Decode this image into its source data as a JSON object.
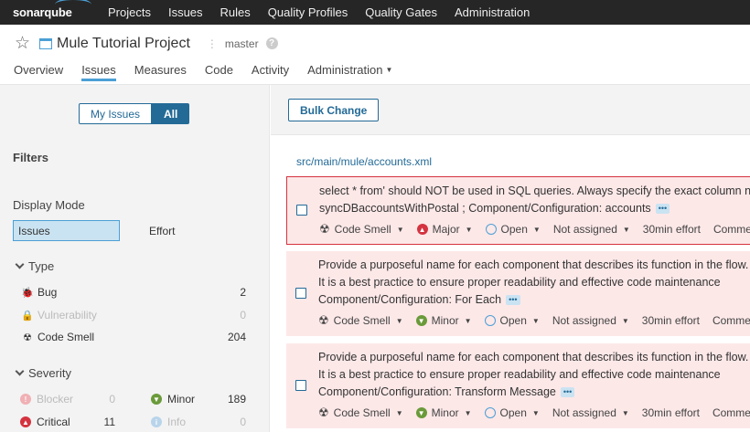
{
  "topnav": {
    "logo": "sonarqube",
    "links": [
      "Projects",
      "Issues",
      "Rules",
      "Quality Profiles",
      "Quality Gates",
      "Administration"
    ]
  },
  "project": {
    "name": "Mule Tutorial Project",
    "branch": "master",
    "tabs": [
      "Overview",
      "Issues",
      "Measures",
      "Code",
      "Activity",
      "Administration"
    ],
    "active_tab": "Issues"
  },
  "sidebar": {
    "toggle": {
      "my_issues": "My Issues",
      "all": "All"
    },
    "filters_title": "Filters",
    "display_mode": {
      "title": "Display Mode",
      "issues": "Issues",
      "effort": "Effort"
    },
    "type": {
      "title": "Type",
      "items": [
        {
          "label": "Bug",
          "count": "2",
          "icon": "bug-icon"
        },
        {
          "label": "Vulnerability",
          "count": "0",
          "icon": "lock-icon"
        },
        {
          "label": "Code Smell",
          "count": "204",
          "icon": "code-smell-icon"
        }
      ]
    },
    "severity": {
      "title": "Severity",
      "items": [
        {
          "label": "Blocker",
          "count": "0"
        },
        {
          "label": "Minor",
          "count": "189"
        },
        {
          "label": "Critical",
          "count": "11"
        },
        {
          "label": "Info",
          "count": "0"
        }
      ]
    }
  },
  "main": {
    "bulk_change": "Bulk Change",
    "file_path": "src/main/mule/accounts.xml",
    "issues": [
      {
        "lines": [
          "select * from' should NOT be used in SQL queries. Always specify the exact column names",
          "syncDBaccountsWithPostal ; Component/Configuration: accounts"
        ],
        "type": "Code Smell",
        "severity": "Major",
        "status": "Open",
        "assignee": "Not assigned",
        "effort": "30min effort",
        "comment": "Comment"
      },
      {
        "lines": [
          "Provide a purposeful name for each component that describes its function in the flow.",
          "It is a best practice to ensure proper readability and effective code maintenance",
          "Component/Configuration: For Each"
        ],
        "type": "Code Smell",
        "severity": "Minor",
        "status": "Open",
        "assignee": "Not assigned",
        "effort": "30min effort",
        "comment": "Comment"
      },
      {
        "lines": [
          "Provide a purposeful name for each component that describes its function in the flow.",
          "It is a best practice to ensure proper readability and effective code maintenance",
          "Component/Configuration: Transform Message"
        ],
        "type": "Code Smell",
        "severity": "Minor",
        "status": "Open",
        "assignee": "Not assigned",
        "effort": "30min effort",
        "comment": "Comment"
      }
    ]
  },
  "colors": {
    "accent": "#236a97",
    "topbar": "#262626",
    "issue_bg": "#fde8e8",
    "major": "#d4333f",
    "minor": "#6a9a3a"
  }
}
